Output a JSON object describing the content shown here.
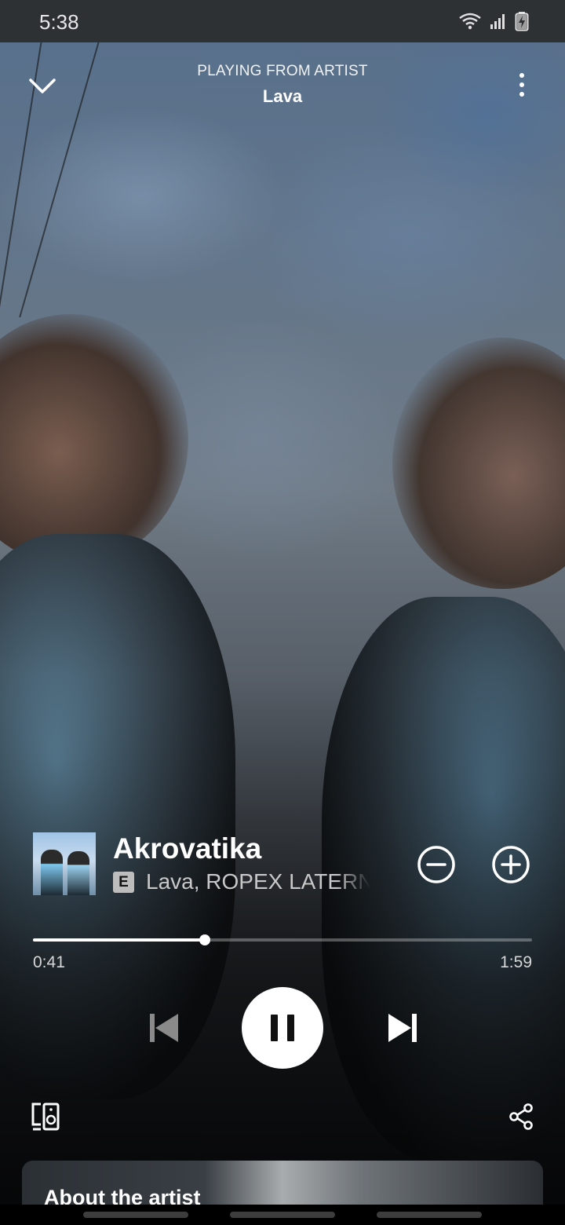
{
  "status_bar": {
    "time": "5:38"
  },
  "header": {
    "context_label": "PLAYING FROM ARTIST",
    "context_name": "Lava"
  },
  "track": {
    "title": "Akrovatika",
    "explicit_badge": "E",
    "artists": "Lava, ROPEX LATERNA"
  },
  "playback": {
    "elapsed": "0:41",
    "total": "1:59",
    "progress_fraction": 0.345
  },
  "artist_card": {
    "label": "About the artist"
  },
  "icons": {
    "collapse": "chevron-down-icon",
    "more": "more-vertical-icon",
    "remove": "minus-circle-icon",
    "add": "plus-circle-icon",
    "previous": "skip-previous-icon",
    "pause": "pause-icon",
    "next": "skip-next-icon",
    "devices": "connect-devices-icon",
    "share": "share-icon"
  },
  "colors": {
    "accent": "#ffffff",
    "play_button_bg": "#ffffff",
    "secondary_text": "#c8c8c8"
  }
}
